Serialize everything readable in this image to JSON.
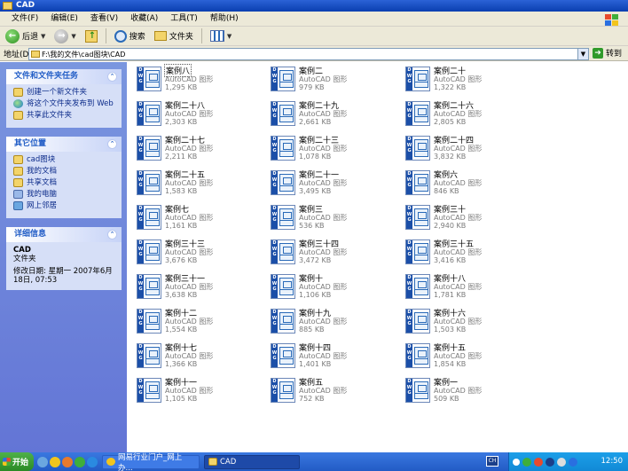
{
  "window": {
    "title": "CAD"
  },
  "menu": [
    "文件(F)",
    "编辑(E)",
    "查看(V)",
    "收藏(A)",
    "工具(T)",
    "帮助(H)"
  ],
  "toolbar": {
    "back_label": "后退",
    "search_label": "搜索",
    "folders_label": "文件夹"
  },
  "address": {
    "label": "地址(D)",
    "value": "F:\\我的文件\\cad图块\\CAD",
    "go_label": "转到"
  },
  "tasks_panel": {
    "title": "文件和文件夹任务",
    "items": [
      "创建一个新文件夹",
      "将这个文件夹发布到 Web",
      "共享此文件夹"
    ]
  },
  "other_panel": {
    "title": "其它位置",
    "items": [
      "cad图块",
      "我的文档",
      "共享文档",
      "我的电脑",
      "网上邻居"
    ]
  },
  "details_panel": {
    "title": "详细信息",
    "name": "CAD",
    "type": "文件夹",
    "modified": "修改日期: 星期一 2007年6月 18日, 07:53"
  },
  "file_type": "AutoCAD 图形",
  "files": [
    {
      "name": "案例八",
      "size": "1,295 KB"
    },
    {
      "name": "案例二",
      "size": "979 KB"
    },
    {
      "name": "案例二十",
      "size": "1,322 KB"
    },
    {
      "name": "案例二十八",
      "size": "2,303 KB"
    },
    {
      "name": "案例二十九",
      "size": "2,661 KB"
    },
    {
      "name": "案例二十六",
      "size": "2,805 KB"
    },
    {
      "name": "案例二十七",
      "size": "2,211 KB"
    },
    {
      "name": "案例二十三",
      "size": "1,078 KB"
    },
    {
      "name": "案例二十四",
      "size": "3,832 KB"
    },
    {
      "name": "案例二十五",
      "size": "1,583 KB"
    },
    {
      "name": "案例二十一",
      "size": "3,495 KB"
    },
    {
      "name": "案例六",
      "size": "846 KB"
    },
    {
      "name": "案例七",
      "size": "1,161 KB"
    },
    {
      "name": "案例三",
      "size": "536 KB"
    },
    {
      "name": "案例三十",
      "size": "2,940 KB"
    },
    {
      "name": "案例三十三",
      "size": "3,676 KB"
    },
    {
      "name": "案例三十四",
      "size": "3,472 KB"
    },
    {
      "name": "案例三十五",
      "size": "3,416 KB"
    },
    {
      "name": "案例三十一",
      "size": "3,638 KB"
    },
    {
      "name": "案例十",
      "size": "1,106 KB"
    },
    {
      "name": "案例十八",
      "size": "1,781 KB"
    },
    {
      "name": "案例十二",
      "size": "1,554 KB"
    },
    {
      "name": "案例十九",
      "size": "885 KB"
    },
    {
      "name": "案例十六",
      "size": "1,503 KB"
    },
    {
      "name": "案例十七",
      "size": "1,366 KB"
    },
    {
      "name": "案例十四",
      "size": "1,401 KB"
    },
    {
      "name": "案例十五",
      "size": "1,854 KB"
    },
    {
      "name": "案例十一",
      "size": "1,105 KB"
    },
    {
      "name": "案例五",
      "size": "752 KB"
    },
    {
      "name": "案例一",
      "size": "509 KB"
    }
  ],
  "taskbar": {
    "start_label": "开始",
    "tasks": [
      "网易行业门户_网上办...",
      "CAD"
    ],
    "language": "CH",
    "clock": "12:50"
  }
}
